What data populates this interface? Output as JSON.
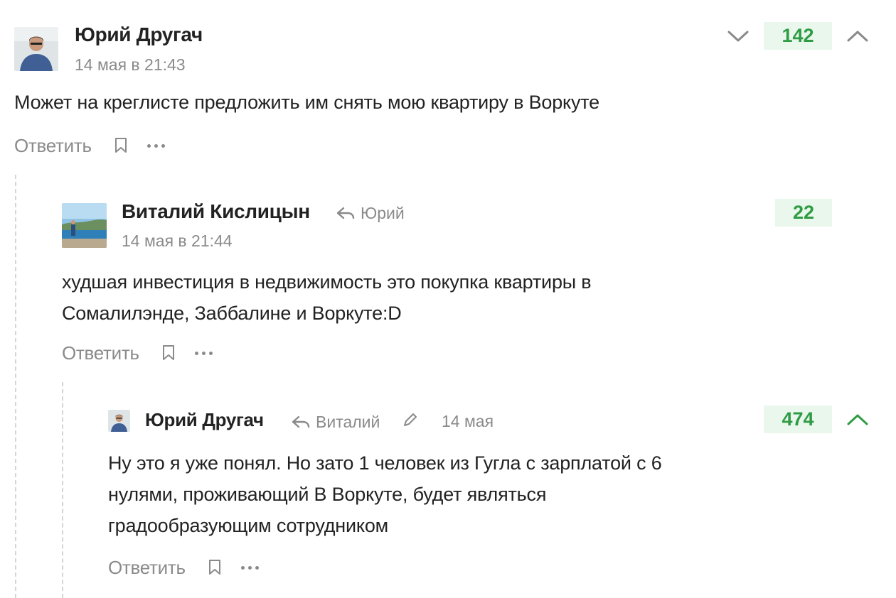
{
  "comments": [
    {
      "author": "Юрий Другач",
      "date": "14 мая в 21:43",
      "text": "Может на креглисте предложить им снять мою квартиру в Воркуте",
      "score": "142",
      "reply_label": "Ответить"
    },
    {
      "author": "Виталий Кислицын",
      "reply_to": "Юрий",
      "date": "14 мая в 21:44",
      "text_lines": [
        "худшая инвестиция в недвижимость это покупка квартиры в",
        "Сомалилэнде, Заббалине и Воркуте:D"
      ],
      "score": "22",
      "reply_label": "Ответить"
    },
    {
      "author": "Юрий Другач",
      "reply_to": "Виталий",
      "date": "14 мая",
      "text_lines": [
        "Ну это я уже понял. Но зато 1 человек из Гугла с зарплатой с 6",
        "нулями, проживающий В Воркуте, будет являться",
        "градообразующим сотрудником"
      ],
      "score": "474",
      "reply_label": "Ответить"
    }
  ],
  "colors": {
    "score_bg": "#e9f7ec",
    "score_text": "#2f9c45",
    "upvoted": "#2f9c45",
    "muted": "#8a8a8a"
  },
  "icons": [
    "vote-down-icon",
    "vote-up-icon",
    "reply-arrow-icon",
    "bookmark-icon",
    "more-dots-icon",
    "edit-pencil-icon"
  ]
}
